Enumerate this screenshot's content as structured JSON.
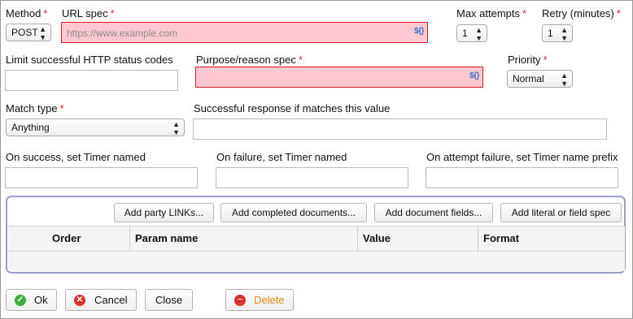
{
  "fields": {
    "method": {
      "label": "Method",
      "value": "POST"
    },
    "url_spec": {
      "label": "URL spec",
      "placeholder": "https://www.example.com",
      "fx": "${}"
    },
    "max_attempts": {
      "label": "Max attempts",
      "value": "1"
    },
    "retry": {
      "label": "Retry (minutes)",
      "value": "1"
    },
    "limit_status": {
      "label": "Limit successful HTTP status codes",
      "value": ""
    },
    "purpose": {
      "label": "Purpose/reason spec",
      "fx": "${}"
    },
    "priority": {
      "label": "Priority",
      "value": "Normal"
    },
    "match_type": {
      "label": "Match type",
      "value": "Anything"
    },
    "success_value": {
      "label": "Successful response if matches this value",
      "value": ""
    },
    "on_success": {
      "label": "On success, set Timer named",
      "value": ""
    },
    "on_failure": {
      "label": "On failure, set Timer named",
      "value": ""
    },
    "on_attempt_failure": {
      "label": "On attempt failure, set Timer name prefix",
      "value": ""
    }
  },
  "required_mark": "*",
  "params": {
    "buttons": [
      "Add party LINKs...",
      "Add completed documents...",
      "Add document fields...",
      "Add literal or field spec"
    ],
    "columns": [
      "Order",
      "Param name",
      "Value",
      "Format"
    ]
  },
  "footer": {
    "ok": "Ok",
    "cancel": "Cancel",
    "close": "Close",
    "delete": "Delete"
  },
  "colors": {
    "error_bg": "#fdc8d2",
    "error_border": "#d11a2a",
    "group_border": "#9aa0c8",
    "delete_text": "#e8861a",
    "required": "#e0252a"
  },
  "icons": {
    "ok": "check-circle-icon",
    "cancel": "x-circle-icon",
    "delete": "minus-circle-icon",
    "spinner": "up-down-arrows-icon",
    "expression": "expression-icon"
  }
}
